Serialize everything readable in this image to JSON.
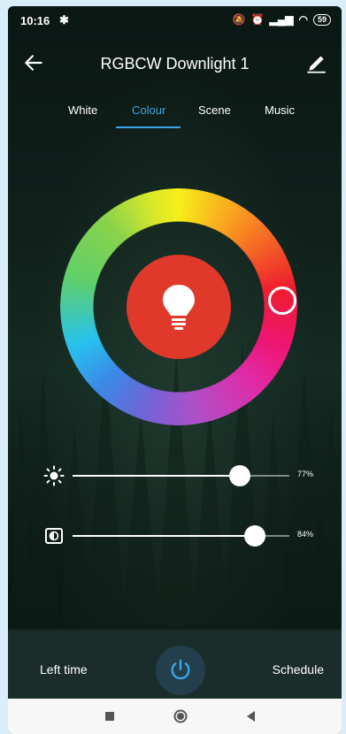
{
  "status_bar": {
    "time": "10:16",
    "battery": "59"
  },
  "header": {
    "title": "RGBCW Downlight 1"
  },
  "tabs": [
    {
      "label": "White",
      "active": false
    },
    {
      "label": "Colour",
      "active": true
    },
    {
      "label": "Scene",
      "active": false
    },
    {
      "label": "Music",
      "active": false
    }
  ],
  "color_wheel": {
    "selected_color": "#e0392b"
  },
  "brightness": {
    "value_label": "77%",
    "fraction": 0.77
  },
  "saturation": {
    "value_label": "84%",
    "fraction": 0.84
  },
  "bottom": {
    "left_label": "Left time",
    "right_label": "Schedule"
  },
  "colors": {
    "accent": "#3ba6e6",
    "power_bg": "#233f4d",
    "bar_bg": "#1b2d2a"
  }
}
